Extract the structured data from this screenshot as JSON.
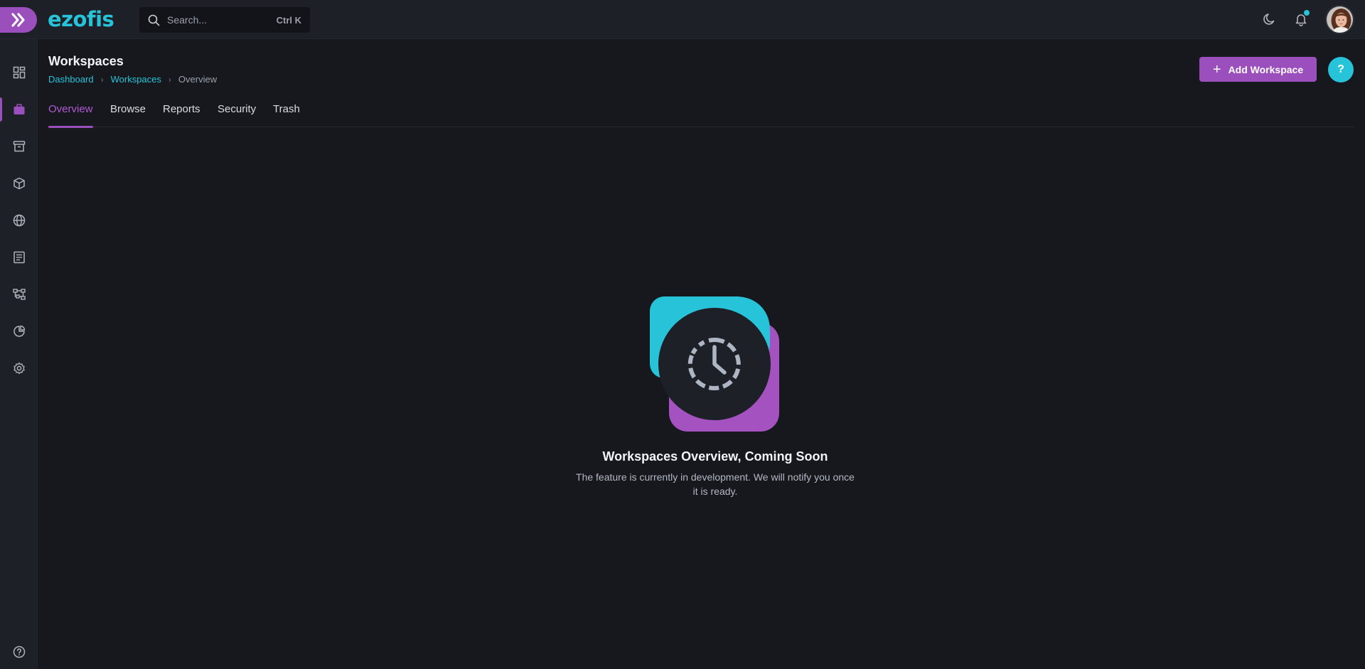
{
  "app": {
    "logo_text": "ezofis",
    "search_placeholder": "Search...",
    "search_shortcut": "Ctrl K",
    "accent_color": "#9b4fbd",
    "brand_color": "#27c3d8"
  },
  "topbar": {
    "icons": [
      "theme-moon-icon",
      "notification-bell-icon",
      "user-avatar"
    ]
  },
  "sidebar": {
    "items": [
      {
        "icon": "dashboard-icon"
      },
      {
        "icon": "briefcase-icon",
        "active": true
      },
      {
        "icon": "archive-box-icon"
      },
      {
        "icon": "cube-icon"
      },
      {
        "icon": "globe-icon"
      },
      {
        "icon": "document-list-icon"
      },
      {
        "icon": "workflow-icon"
      },
      {
        "icon": "pie-chart-icon"
      },
      {
        "icon": "settings-gear-icon"
      }
    ],
    "bottom_icon": "help-circle-icon"
  },
  "page": {
    "title": "Workspaces",
    "breadcrumb": [
      "Dashboard",
      "Workspaces",
      "Overview"
    ],
    "add_button_label": "Add Workspace",
    "help_label": "?"
  },
  "tabs": [
    {
      "label": "Overview",
      "active": true
    },
    {
      "label": "Browse"
    },
    {
      "label": "Reports"
    },
    {
      "label": "Security"
    },
    {
      "label": "Trash"
    }
  ],
  "empty_state": {
    "title": "Workspaces Overview, Coming Soon",
    "description": "The feature is currently in development. We will notify you once it is ready.",
    "icon": "clock-icon"
  }
}
